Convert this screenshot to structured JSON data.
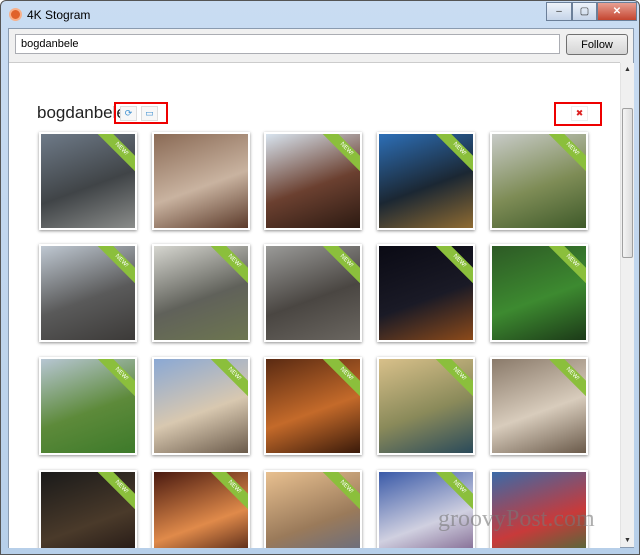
{
  "window": {
    "title": "4K Stogram",
    "minimize": "–",
    "maximize": "▢",
    "close": "✕"
  },
  "search": {
    "value": "bogdanbele",
    "follow_label": "Follow"
  },
  "profile": {
    "username": "bogdanbele",
    "refresh_icon": "refresh-icon",
    "folder_icon": "folder-icon",
    "remove_icon": "✖"
  },
  "badge": "NEW!",
  "photos": [
    {
      "new": true,
      "colors": [
        "#6e7a88",
        "#404447",
        "#8a8c8a"
      ]
    },
    {
      "new": false,
      "colors": [
        "#8a6a55",
        "#c9b3a0",
        "#5b3a2a"
      ]
    },
    {
      "new": true,
      "colors": [
        "#d8e4ef",
        "#6b4030",
        "#2c1a12"
      ]
    },
    {
      "new": true,
      "colors": [
        "#2d6fb7",
        "#1b2733",
        "#8f6b32"
      ]
    },
    {
      "new": true,
      "colors": [
        "#c8cbc8",
        "#7e8c56",
        "#3f5a2a"
      ]
    },
    {
      "new": true,
      "colors": [
        "#bfc8d2",
        "#5a5a5a",
        "#3c3a38"
      ]
    },
    {
      "new": true,
      "colors": [
        "#d6d6d0",
        "#60615a",
        "#6d7650"
      ]
    },
    {
      "new": true,
      "colors": [
        "#9a9a98",
        "#4a4642",
        "#6a6660"
      ]
    },
    {
      "new": true,
      "colors": [
        "#0a0a14",
        "#1a1a26",
        "#8c4a1a"
      ]
    },
    {
      "new": true,
      "colors": [
        "#2d5a25",
        "#3d8a30",
        "#1c3a18"
      ]
    },
    {
      "new": true,
      "colors": [
        "#b7c6d3",
        "#5d8a3a",
        "#3d7a2a"
      ]
    },
    {
      "new": true,
      "colors": [
        "#8aa8d4",
        "#d8c8b0",
        "#6a5a4a"
      ]
    },
    {
      "new": true,
      "colors": [
        "#5a2a12",
        "#c46a2a",
        "#3a1a0a"
      ]
    },
    {
      "new": true,
      "colors": [
        "#d8c08a",
        "#8a8a5a",
        "#2a4a5a"
      ]
    },
    {
      "new": true,
      "colors": [
        "#8a7a6a",
        "#d8ccbc",
        "#6a5a4a"
      ]
    },
    {
      "new": true,
      "colors": [
        "#1a1a1a",
        "#4a3a2a",
        "#1a1010"
      ]
    },
    {
      "new": true,
      "colors": [
        "#4a1a10",
        "#e08a4a",
        "#2a0a08"
      ]
    },
    {
      "new": true,
      "colors": [
        "#e8c090",
        "#9a7a5a",
        "#5a6a8a"
      ]
    },
    {
      "new": true,
      "colors": [
        "#3a5aa8",
        "#d0d0e0",
        "#6a4a7a"
      ]
    },
    {
      "new": false,
      "colors": [
        "#3a6aa8",
        "#c83a3a",
        "#2a7a3a"
      ]
    }
  ],
  "watermark": "groovyPost.com"
}
